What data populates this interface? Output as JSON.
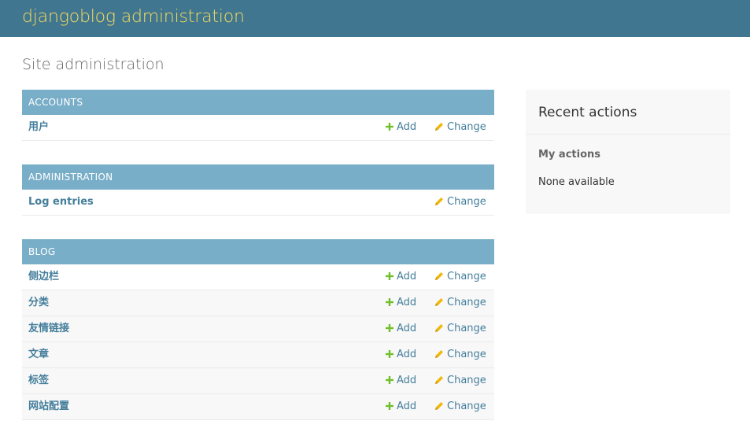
{
  "header": {
    "site_title": "djangoblog administration"
  },
  "page": {
    "title": "Site administration"
  },
  "modules": [
    {
      "caption": "ACCOUNTS",
      "rows": [
        {
          "name": "用户",
          "add": "Add",
          "change": "Change"
        }
      ]
    },
    {
      "caption": "ADMINISTRATION",
      "rows": [
        {
          "name": "Log entries",
          "change": "Change"
        }
      ]
    },
    {
      "caption": "BLOG",
      "rows": [
        {
          "name": "侧边栏",
          "add": "Add",
          "change": "Change"
        },
        {
          "name": "分类",
          "add": "Add",
          "change": "Change"
        },
        {
          "name": "友情链接",
          "add": "Add",
          "change": "Change"
        },
        {
          "name": "文章",
          "add": "Add",
          "change": "Change"
        },
        {
          "name": "标签",
          "add": "Add",
          "change": "Change"
        },
        {
          "name": "网站配置",
          "add": "Add",
          "change": "Change"
        }
      ]
    }
  ],
  "recent_actions": {
    "title": "Recent actions",
    "my_actions_label": "My actions",
    "empty_text": "None available"
  },
  "colors": {
    "header_bg": "#417690",
    "site_title": "#f5dd5d",
    "module_caption_bg": "#79aec8",
    "link": "#447e9b",
    "add_icon": "#70bf2b",
    "change_icon": "#efb80b"
  },
  "icons": {
    "add": "plus-icon",
    "change": "pencil-icon"
  }
}
